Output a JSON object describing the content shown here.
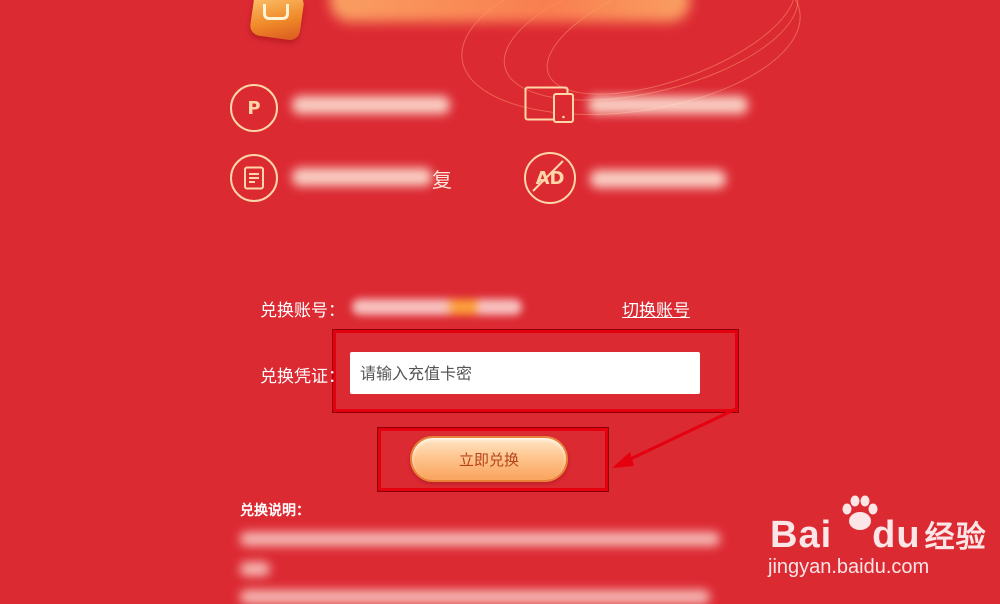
{
  "banner": {
    "logo": "crown-logo-icon"
  },
  "features": [
    {
      "icon": "pdf-convert-icon",
      "icon_glyph": "P"
    },
    {
      "icon": "multi-device-icon"
    },
    {
      "icon": "document-restore-icon",
      "label_visible": "复"
    },
    {
      "icon": "no-ads-icon",
      "icon_glyph": "AD"
    }
  ],
  "form": {
    "account_label": "兑换账号：",
    "switch_account": "切换账号",
    "voucher_label": "兑换凭证：",
    "voucher_placeholder": "请输入充值卡密",
    "redeem_button": "立即兑换"
  },
  "notes": {
    "title": "兑换说明："
  },
  "watermark": {
    "brand_bai": "Bai",
    "brand_du": "du",
    "brand_jy": "经验",
    "url": "jingyan.baidu.com"
  },
  "colors": {
    "background": "#dc2a33",
    "highlight": "#e5000f",
    "button_text": "#b5431a"
  }
}
